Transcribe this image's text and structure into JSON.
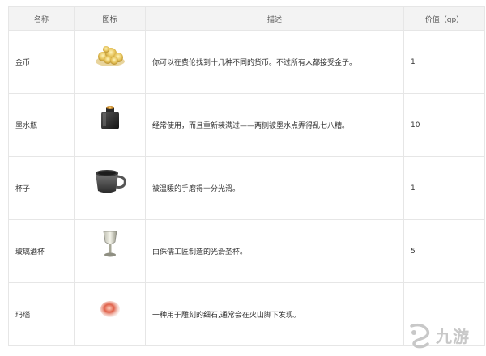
{
  "table": {
    "headers": {
      "name": "名称",
      "icon": "图标",
      "description": "描述",
      "value": "价值（gp）"
    },
    "rows": [
      {
        "name": "金币",
        "icon": "gold-coins-icon",
        "description": "你可以在费伦找到十几种不同的货币。不过所有人都接受金子。",
        "value": "1"
      },
      {
        "name": "墨水瓶",
        "icon": "ink-bottle-icon",
        "description": "经常使用，而且重新装满过——两侧被墨水点弄得乱七八糟。",
        "value": "10"
      },
      {
        "name": "杯子",
        "icon": "cup-icon",
        "description": "被温暖的手磨得十分光滑。",
        "value": "1"
      },
      {
        "name": "玻璃酒杯",
        "icon": "wine-glass-icon",
        "description": "由侏儒工匠制造的光滑圣杯。",
        "value": "5"
      },
      {
        "name": "玛瑙",
        "icon": "agate-gem-icon",
        "description": "一种用于雕刻的细石,通常会在火山脚下发现。",
        "value": ""
      }
    ]
  },
  "watermark": {
    "logo_icon": "jiuyou-logo-icon",
    "text": "九游"
  }
}
